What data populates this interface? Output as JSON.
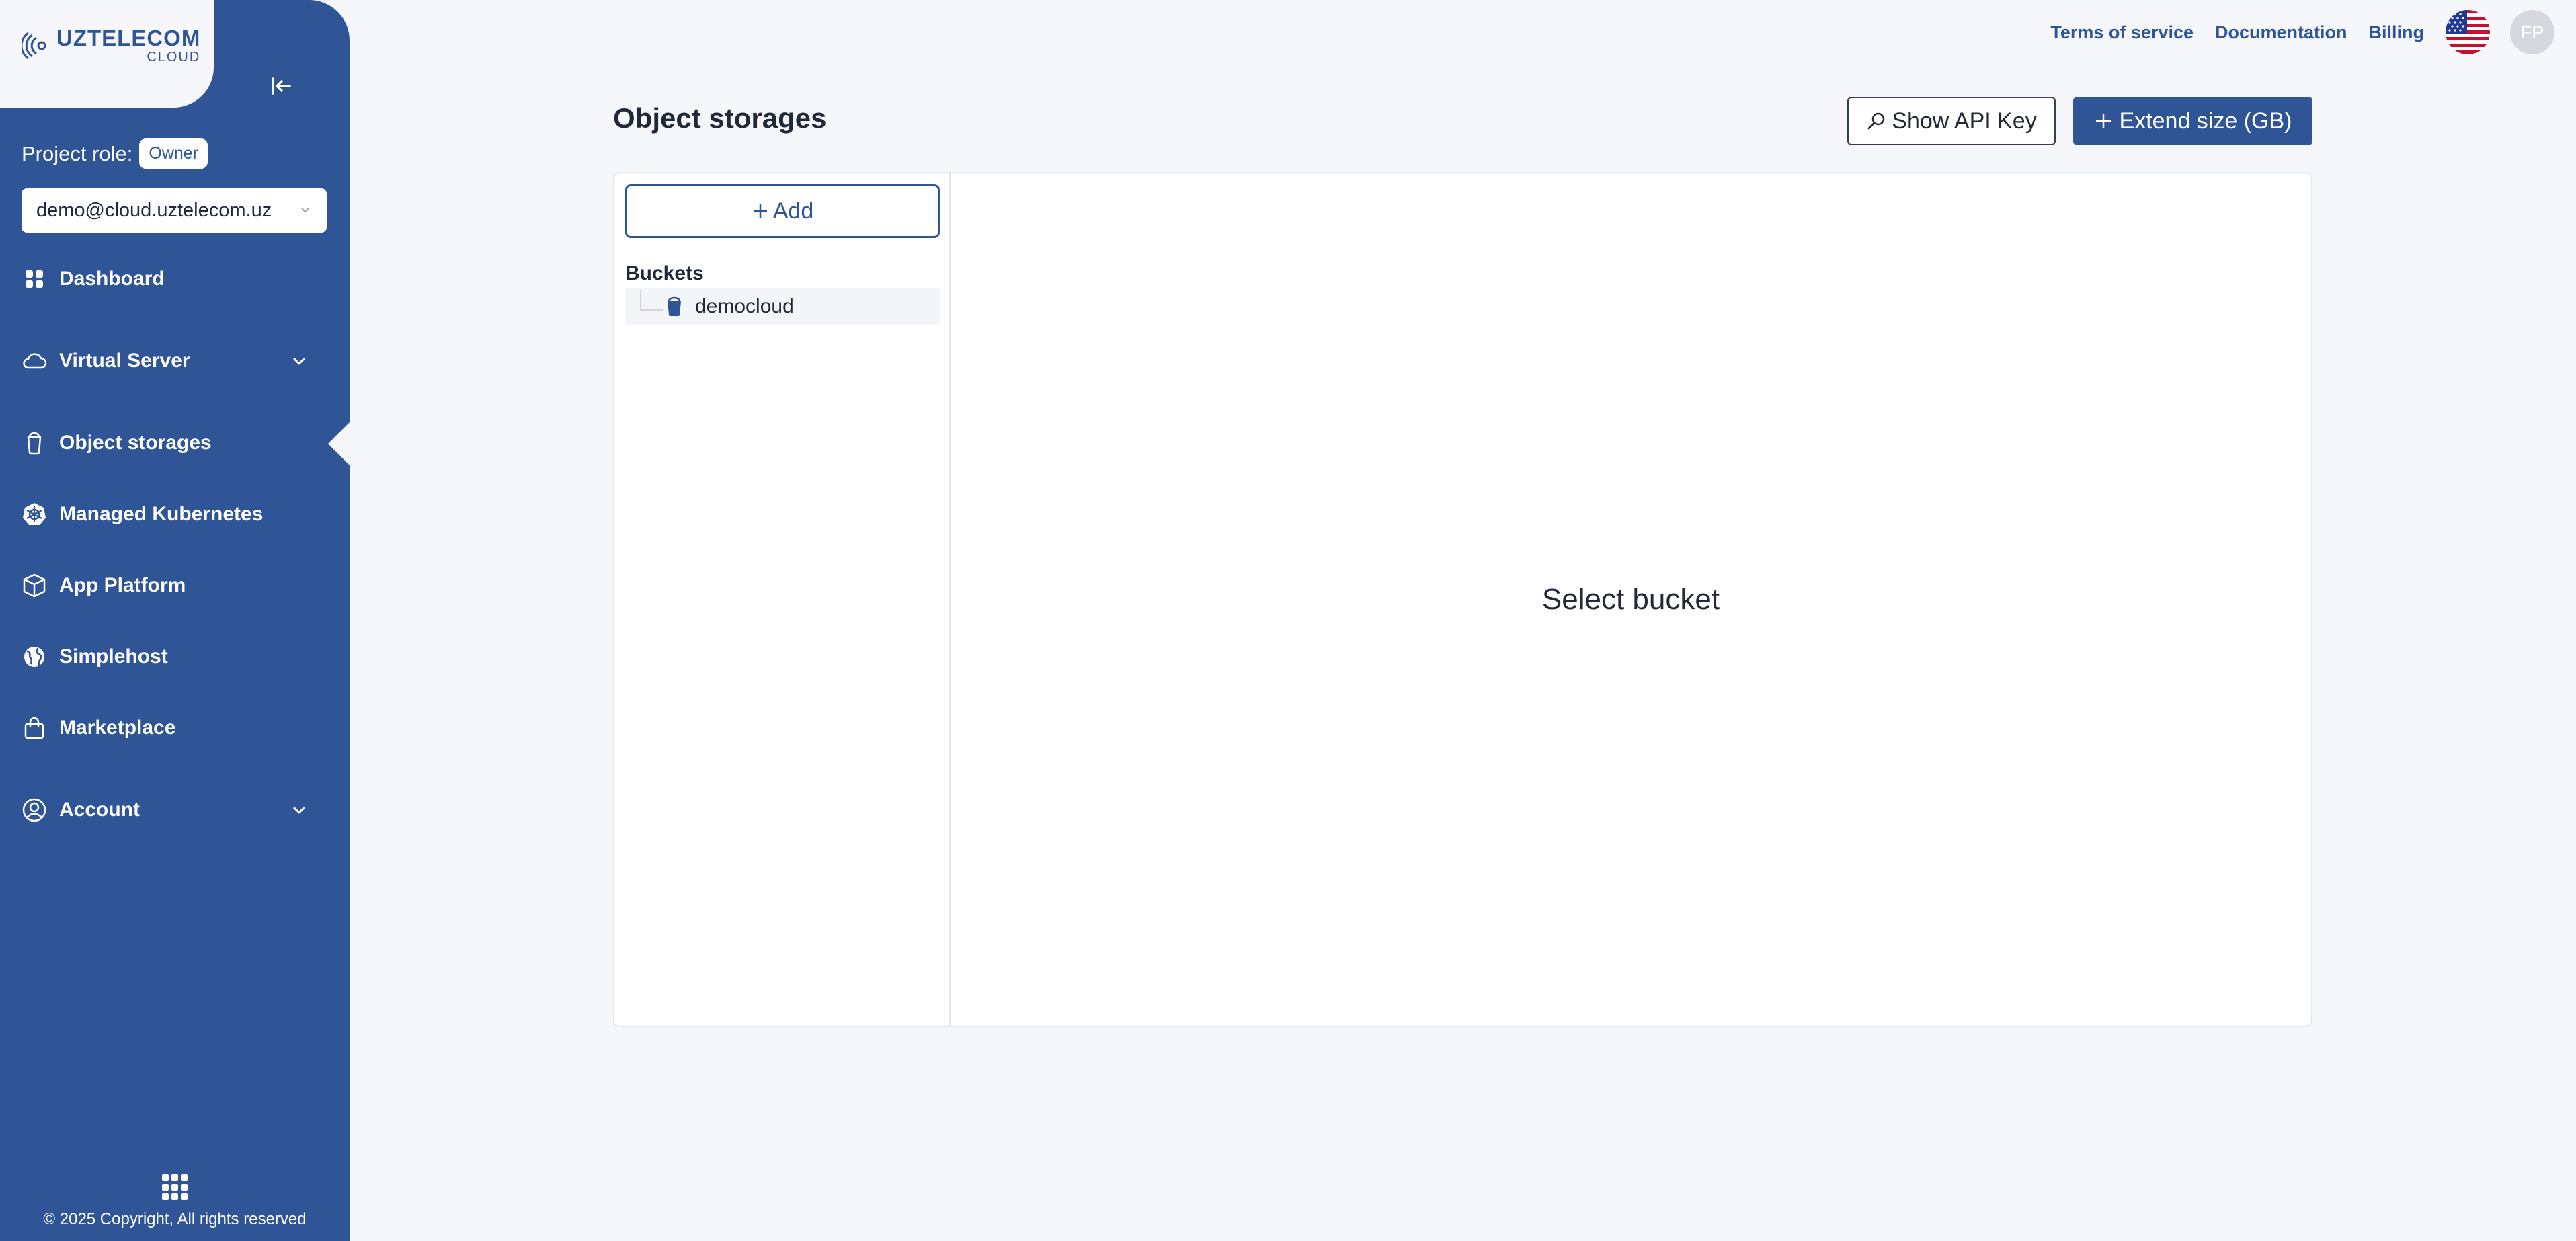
{
  "brand": {
    "name": "UZTELECOM",
    "sub": "CLOUD"
  },
  "sidebar": {
    "project_role_label": "Project role:",
    "project_role_value": "Owner",
    "project_select_value": "demo@cloud.uztelecom.uz",
    "items": [
      {
        "label": "Dashboard",
        "icon": "dashboard-icon"
      },
      {
        "label": "Virtual Server",
        "icon": "cloud-icon",
        "expandable": true
      },
      {
        "label": "Object storages",
        "icon": "bucket-icon",
        "active": true
      },
      {
        "label": "Managed Kubernetes",
        "icon": "kubernetes-icon"
      },
      {
        "label": "App Platform",
        "icon": "box-icon"
      },
      {
        "label": "Simplehost",
        "icon": "globe-icon"
      },
      {
        "label": "Marketplace",
        "icon": "bag-icon"
      },
      {
        "label": "Account",
        "icon": "user-circle-icon",
        "expandable": true
      }
    ],
    "copyright": "© 2025 Copyright, All rights reserved"
  },
  "topnav": {
    "terms": "Terms of service",
    "docs": "Documentation",
    "billing": "Billing",
    "avatar_initials": "FP"
  },
  "main": {
    "title": "Object storages",
    "show_api_key": "Show API Key",
    "extend_size": "Extend size (GB)",
    "add_label": "Add",
    "buckets_heading": "Buckets",
    "buckets": [
      "democloud"
    ],
    "empty_message": "Select bucket"
  },
  "colors": {
    "primary": "#2f5596",
    "background": "#f5f7fa"
  }
}
